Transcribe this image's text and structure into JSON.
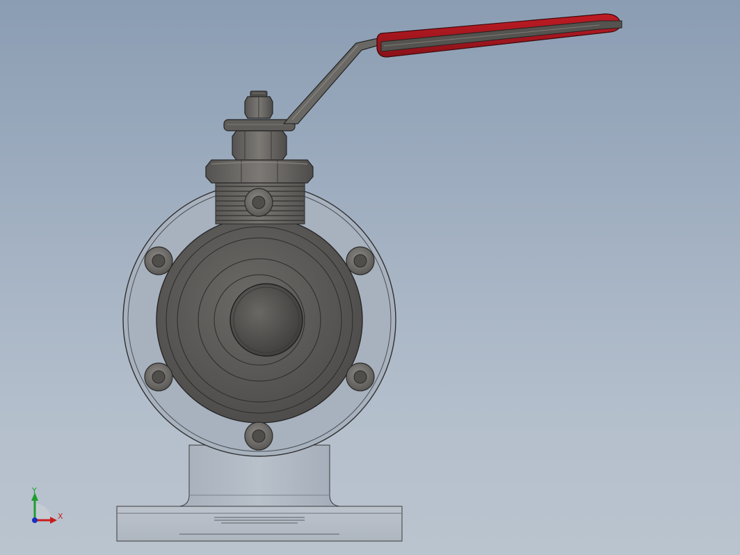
{
  "viewport": {
    "background_top": "#8b9db3",
    "background_bottom": "#bac4cf"
  },
  "model": {
    "subject": "ball-valve",
    "view": "front",
    "handle_color": "#a3161e",
    "body_color": "#5e5c5a",
    "flange_color": "#a8b2be",
    "base_color": "#b7bec7",
    "bolt_count": 6
  },
  "triad": {
    "x_label": "X",
    "y_label": "Y",
    "x_color": "#c81e1e",
    "y_color": "#1d9e2e",
    "z_color": "#1a2fbf"
  }
}
